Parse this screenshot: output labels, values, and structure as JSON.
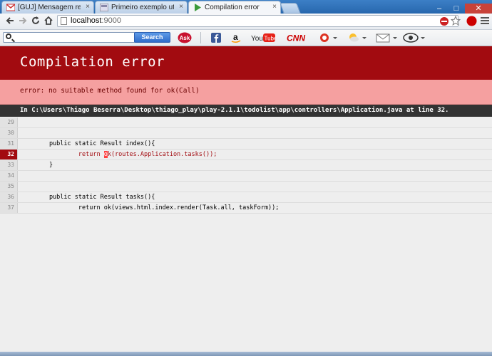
{
  "tabs": [
    {
      "title": "[GUJ] Mensagem respond",
      "icon": "gmail-icon",
      "close": "×"
    },
    {
      "title": "Primeiro exemplo utiliza",
      "icon": "guj-icon",
      "close": "×"
    },
    {
      "title": "Compilation error",
      "icon": "play-icon",
      "close": "×"
    }
  ],
  "window_controls": {
    "minimize": "–",
    "maximize": "□",
    "close": "✕"
  },
  "url": {
    "host": "localhost",
    "port": ":9000"
  },
  "toolbar": {
    "search_button": "Search",
    "ask_label": "Ask",
    "youtube_label": "You",
    "youtube_tube": "Tube",
    "cnn_label": "CNN"
  },
  "page": {
    "title": "Compilation error",
    "error_message": "error: no suitable method found for ok(Call)",
    "file_info": "In C:\\Users\\Thiago Beserra\\Desktop\\thiago_play\\play-2.1.1\\todolist\\app\\controllers\\Application.java at line 32."
  },
  "code_lines": [
    {
      "num": "29",
      "text": "",
      "error": false
    },
    {
      "num": "30",
      "text": "",
      "error": false
    },
    {
      "num": "31",
      "text": "        public static Result index(){",
      "error": false
    },
    {
      "num": "32",
      "text_before": "                return ",
      "text_hl": "o",
      "text_after": "k(routes.Application.tasks());",
      "error": true
    },
    {
      "num": "33",
      "text": "        }",
      "error": false
    },
    {
      "num": "34",
      "text": "",
      "error": false
    },
    {
      "num": "35",
      "text": "",
      "error": false
    },
    {
      "num": "36",
      "text": "        public static Result tasks(){",
      "error": false
    },
    {
      "num": "37",
      "text": "                return ok(views.html.index.render(Task.all, taskForm));",
      "error": false
    }
  ],
  "colors": {
    "header": "#a20b10",
    "message_bar": "#f5a0a0",
    "file_bar": "#333333"
  }
}
